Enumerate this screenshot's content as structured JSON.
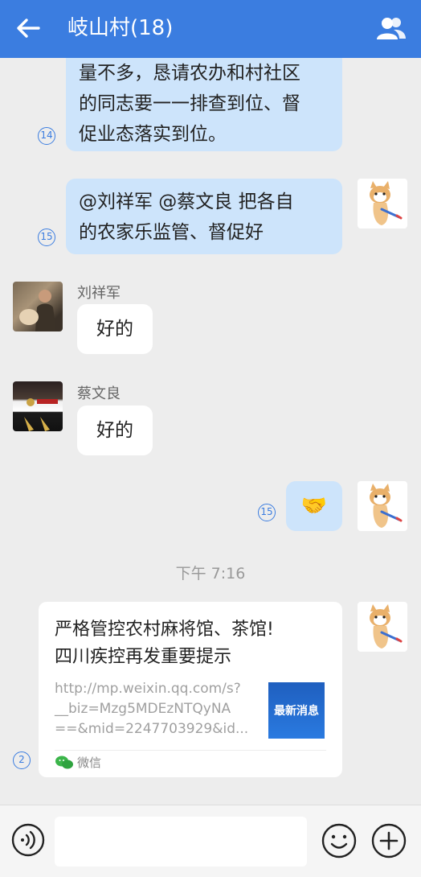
{
  "header": {
    "title": "岐山村(18)"
  },
  "messages": {
    "m14": {
      "badge": "14",
      "lines": [
        "量不多，恳请农办和村社区",
        "的同志要一一排查到位、督",
        "促业态落实到位。"
      ]
    },
    "m15": {
      "badge": "15",
      "lines": [
        "@刘祥军  @蔡文良  把各自",
        "的农家乐监管、督促好"
      ]
    },
    "liu": {
      "sender": "刘祥军",
      "text": "好的"
    },
    "cai": {
      "sender": "蔡文良",
      "text": "好的"
    },
    "shake": {
      "badge": "15",
      "text": "🤝"
    },
    "time": "下午 7:16",
    "link": {
      "badge": "2",
      "title_lines": [
        "严格管控农村麻将馆、茶馆!",
        "四川疾控再发重要提示"
      ],
      "url_lines": [
        "http://mp.weixin.qq.com/s?",
        "__biz=Mzg5MDEzNTQyNA",
        "==&mid=2247703929&id..."
      ],
      "thumb_text": "最新消息",
      "source": "微信"
    }
  },
  "input": {
    "placeholder": ""
  },
  "colors": {
    "header": "#3b7de0",
    "bubble_self": "#cde4fb",
    "bubble_other": "#ffffff",
    "background": "#ededed"
  },
  "icons": {
    "back": "arrow-left",
    "group": "group-members",
    "voice": "voice",
    "emoji": "smiley",
    "more": "plus"
  }
}
